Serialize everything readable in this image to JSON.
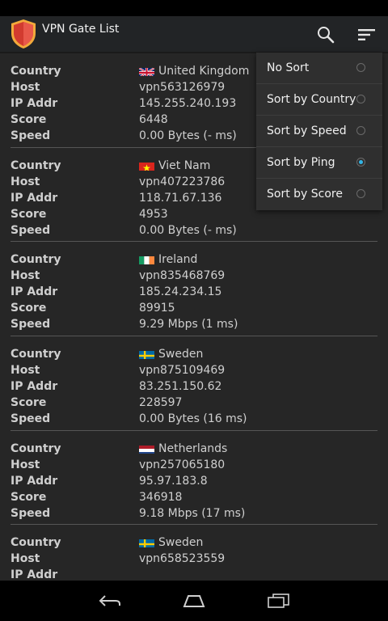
{
  "app": {
    "title": "VPN Gate List"
  },
  "labels": {
    "country": "Country",
    "host": "Host",
    "ip": "IP Addr",
    "score": "Score",
    "speed": "Speed"
  },
  "servers": [
    {
      "country": "United Kingdom",
      "flag": "uk",
      "host": "vpn563126979",
      "ip": "145.255.240.193",
      "score": "6448",
      "speed": "0.00 Bytes (- ms)"
    },
    {
      "country": "Viet Nam",
      "flag": "vn",
      "host": "vpn407223786",
      "ip": "118.71.67.136",
      "score": "4953",
      "speed": "0.00 Bytes (- ms)"
    },
    {
      "country": "Ireland",
      "flag": "ie",
      "host": "vpn835468769",
      "ip": "185.24.234.15",
      "score": "89915",
      "speed": "9.29 Mbps (1 ms)"
    },
    {
      "country": "Sweden",
      "flag": "se",
      "host": "vpn875109469",
      "ip": "83.251.150.62",
      "score": "228597",
      "speed": "0.00 Bytes (16 ms)"
    },
    {
      "country": "Netherlands",
      "flag": "nl",
      "host": "vpn257065180",
      "ip": "95.97.183.8",
      "score": "346918",
      "speed": "9.18 Mbps (17 ms)"
    },
    {
      "country": "Sweden",
      "flag": "se",
      "host": "vpn658523559",
      "ip": "",
      "score": "",
      "speed": ""
    }
  ],
  "sort_menu": {
    "items": [
      {
        "label": "No Sort",
        "checked": false
      },
      {
        "label": "Sort by Country",
        "checked": false
      },
      {
        "label": "Sort by Speed",
        "checked": false
      },
      {
        "label": "Sort by Ping",
        "checked": true
      },
      {
        "label": "Sort by Score",
        "checked": false
      }
    ]
  },
  "colors": {
    "accent": "#33b5e5",
    "actionbar": "#222426",
    "background": "#262626"
  },
  "icons": {
    "search": "search-icon",
    "sort": "sort-icon",
    "back": "back-icon",
    "home": "home-icon",
    "recents": "recents-icon"
  }
}
